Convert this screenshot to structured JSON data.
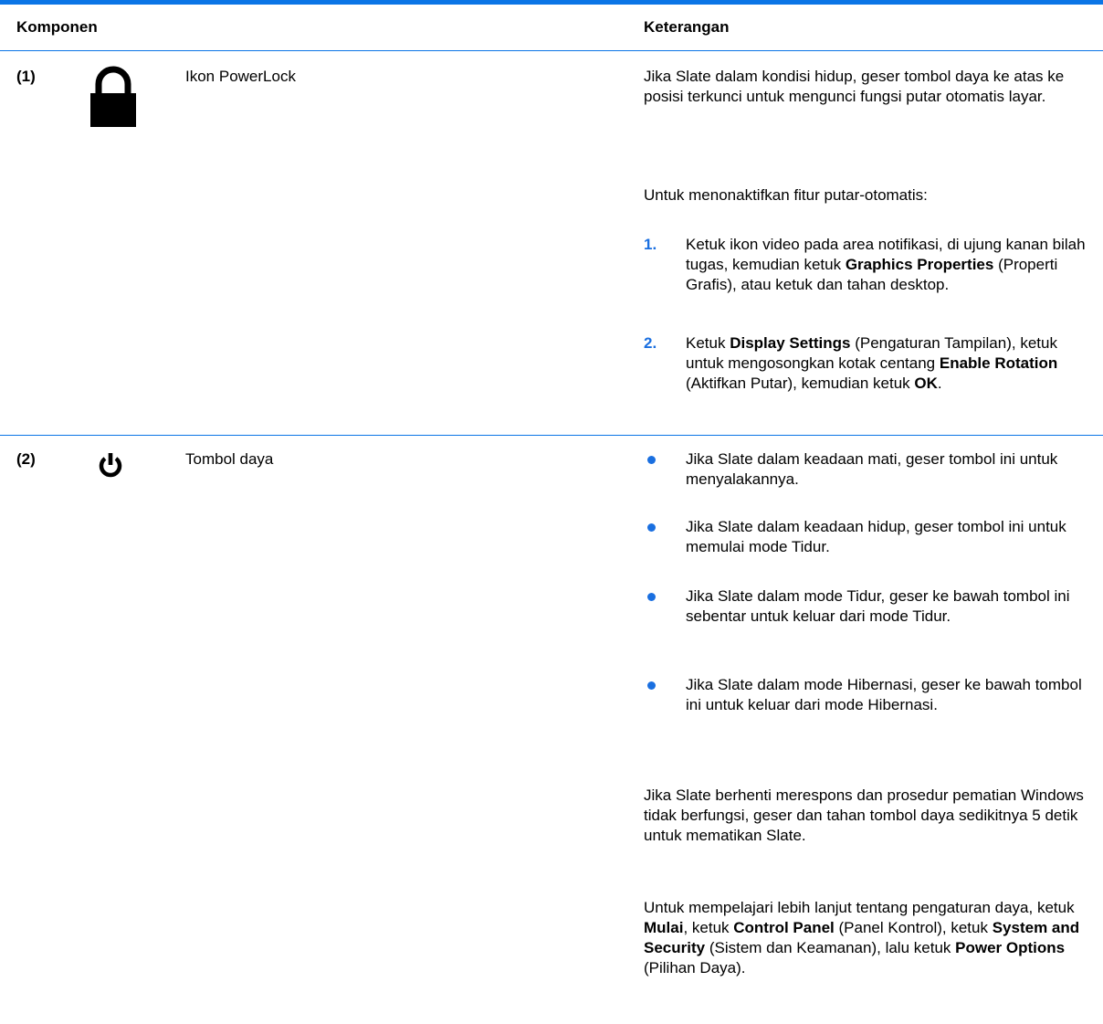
{
  "table": {
    "headers": {
      "component": "Komponen",
      "description": "Keterangan"
    },
    "row1": {
      "number": "(1)",
      "icon": "padlock-icon",
      "name": "Ikon PowerLock",
      "intro": "Jika Slate dalam kondisi hidup, geser tombol daya ke atas ke posisi terkunci untuk mengunci fungsi putar otomatis layar.",
      "steps_intro": "Untuk menonaktifkan fitur putar-otomatis:",
      "steps": [
        {
          "marker": "1.",
          "parts": [
            "Ketuk ikon video pada area notifikasi, di ujung kanan bilah tugas, kemudian ketuk ",
            "Graphics Properties",
            " (Properti Grafis), atau ketuk dan tahan desktop."
          ]
        },
        {
          "marker": "2.",
          "parts": [
            "Ketuk ",
            "Display Settings",
            " (Pengaturan Tampilan), ketuk untuk mengosongkan kotak centang ",
            "Enable Rotation",
            " (Aktifkan Putar), kemudian ketuk ",
            "OK",
            "."
          ]
        }
      ]
    },
    "row2": {
      "number": "(2)",
      "icon": "power-icon",
      "name": "Tombol daya",
      "bullets": [
        "Jika Slate dalam keadaan mati, geser tombol ini untuk menyalakannya.",
        "Jika Slate dalam keadaan hidup, geser tombol ini untuk memulai mode Tidur.",
        "Jika Slate dalam mode Tidur, geser ke bawah tombol ini sebentar untuk keluar dari mode Tidur.",
        "Jika Slate dalam mode Hibernasi, geser ke bawah tombol ini untuk keluar dari mode Hibernasi."
      ],
      "para1": "Jika Slate berhenti merespons dan prosedur pematian Windows tidak berfungsi, geser dan tahan tombol daya sedikitnya 5 detik untuk mematikan Slate.",
      "para2_parts": [
        "Untuk mempelajari lebih lanjut tentang pengaturan daya, ketuk ",
        "Mulai",
        ", ketuk ",
        "Control Panel",
        " (Panel Kontrol), ketuk ",
        "System and Security",
        " (Sistem dan Keamanan), lalu ketuk ",
        "Power Options",
        " (Pilihan Daya)."
      ]
    }
  },
  "colors": {
    "rule": "#0b75e6",
    "marker": "#1a6fe0"
  }
}
